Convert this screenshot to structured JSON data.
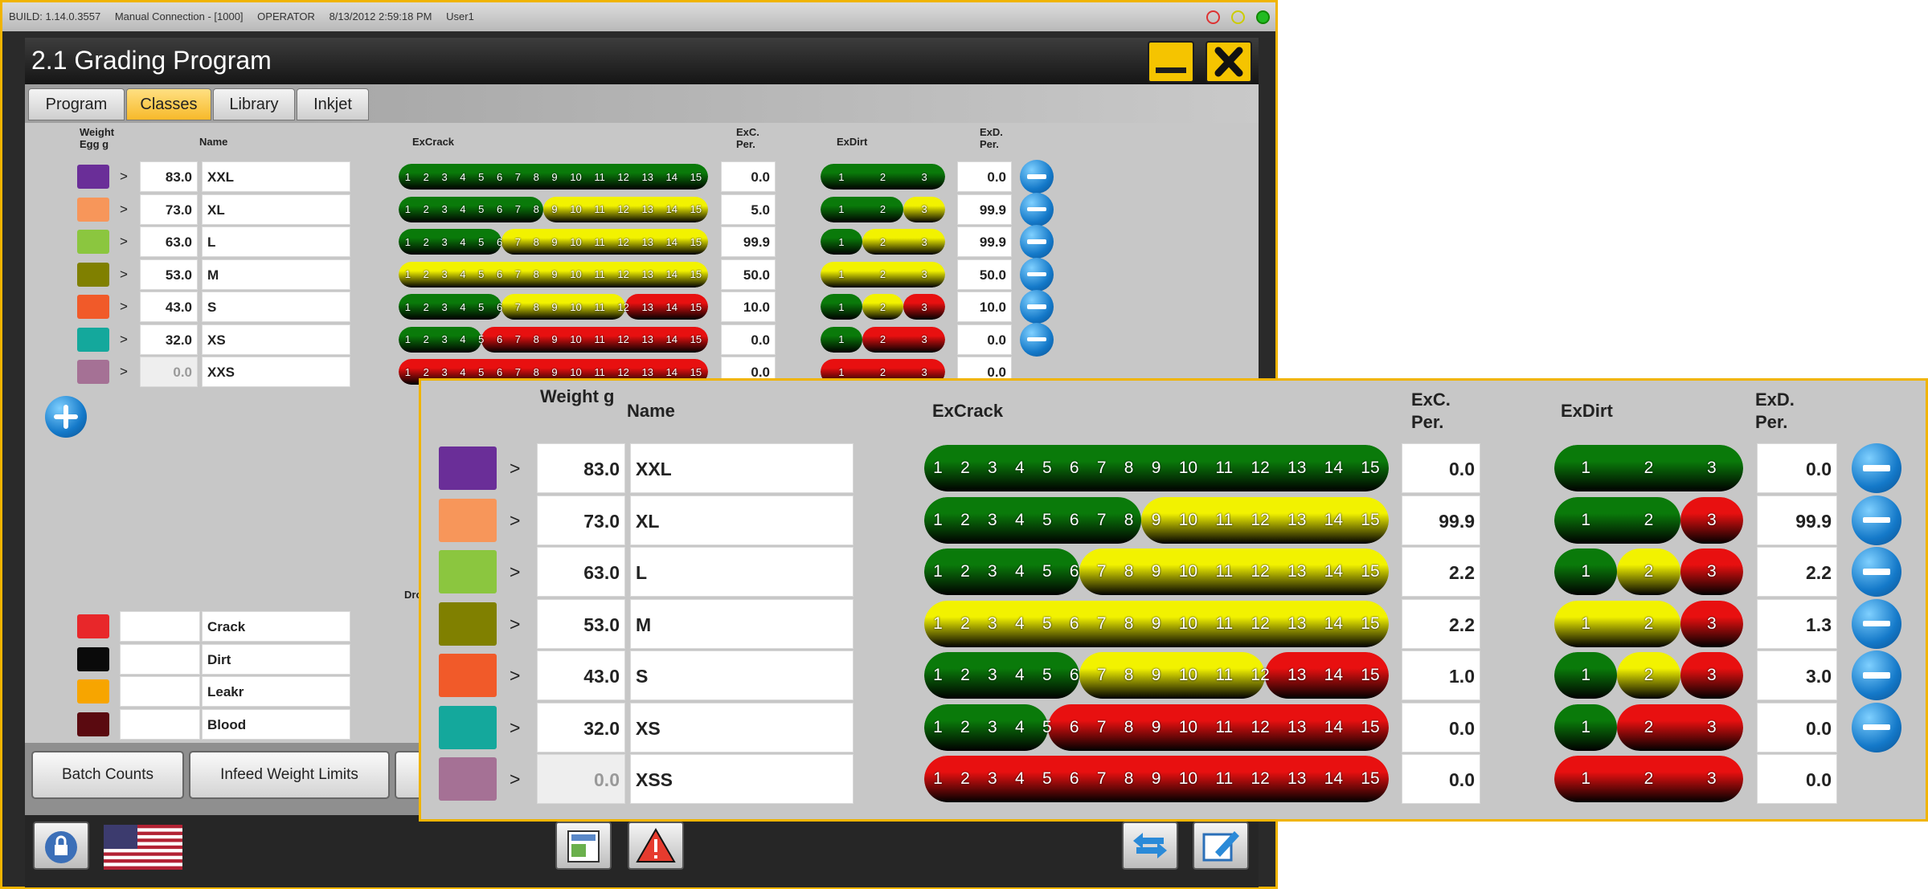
{
  "sysbar": {
    "build": "BUILD: 1.14.0.3557",
    "connection": "Manual Connection - [1000]",
    "role": "OPERATOR",
    "datetime": "8/13/2012 2:59:18 PM",
    "user": "User1"
  },
  "window": {
    "title": "2.1 Grading Program",
    "minimize_icon": "minimize-icon",
    "close_icon": "close-x-icon"
  },
  "tabs": [
    {
      "label": "Program",
      "active": false
    },
    {
      "label": "Classes",
      "active": true
    },
    {
      "label": "Library",
      "active": false
    },
    {
      "label": "Inkjet",
      "active": false
    }
  ],
  "headers": {
    "weight": "Weight Egg  g",
    "name": "Name",
    "excrack": "ExCrack",
    "excper": "ExC. Per.",
    "exdirt": "ExDirt",
    "exdper": "ExD. Per."
  },
  "crack_scale": [
    "1",
    "2",
    "3",
    "4",
    "5",
    "6",
    "7",
    "8",
    "9",
    "10",
    "11",
    "12",
    "13",
    "14",
    "15"
  ],
  "dirt_scale": [
    "1",
    "2",
    "3"
  ],
  "colors": {
    "green": "#0a7a0a",
    "yellow": "#f2f200",
    "red": "#e81010",
    "accent": "#f5c400"
  },
  "classes": [
    {
      "color": "#6a2e98",
      "op": ">",
      "weight": "83.0",
      "name": "XXL",
      "excrack": [
        [
          "g",
          15
        ]
      ],
      "excper": "0.0",
      "exdirt": [
        [
          "g",
          3
        ]
      ],
      "exdper": "0.0",
      "removable": true
    },
    {
      "color": "#f7965a",
      "op": ">",
      "weight": "73.0",
      "name": "XL",
      "excrack": [
        [
          "g",
          7
        ],
        [
          "y",
          8
        ]
      ],
      "excper": "5.0",
      "exdirt": [
        [
          "g",
          2
        ],
        [
          "y",
          1
        ]
      ],
      "exdper": "99.9",
      "removable": true
    },
    {
      "color": "#8bc63f",
      "op": ">",
      "weight": "63.0",
      "name": "L",
      "excrack": [
        [
          "g",
          5
        ],
        [
          "y",
          10
        ]
      ],
      "excper": "99.9",
      "exdirt": [
        [
          "g",
          1
        ],
        [
          "y",
          2
        ]
      ],
      "exdper": "99.9",
      "removable": true
    },
    {
      "color": "#808000",
      "op": ">",
      "weight": "53.0",
      "name": "M",
      "excrack": [
        [
          "y",
          15
        ]
      ],
      "excper": "50.0",
      "exdirt": [
        [
          "y",
          3
        ]
      ],
      "exdper": "50.0",
      "removable": true
    },
    {
      "color": "#f15a29",
      "op": ">",
      "weight": "43.0",
      "name": "S",
      "excrack": [
        [
          "g",
          5
        ],
        [
          "y",
          6
        ],
        [
          "r",
          4
        ]
      ],
      "excper": "10.0",
      "exdirt": [
        [
          "g",
          1
        ],
        [
          "y",
          1
        ],
        [
          "r",
          1
        ]
      ],
      "exdper": "10.0",
      "removable": true
    },
    {
      "color": "#14a89c",
      "op": ">",
      "weight": "32.0",
      "name": "XS",
      "excrack": [
        [
          "g",
          4
        ],
        [
          "r",
          11
        ]
      ],
      "excper": "0.0",
      "exdirt": [
        [
          "g",
          1
        ],
        [
          "r",
          2
        ]
      ],
      "exdper": "0.0",
      "removable": true
    },
    {
      "color": "#a57195",
      "op": ">",
      "weight": "0.0",
      "name": "XXS",
      "excrack": [
        [
          "r",
          15
        ]
      ],
      "excper": "0.0",
      "exdirt": [
        [
          "r",
          3
        ]
      ],
      "exdper": "0.0",
      "removable": false
    }
  ],
  "defects": [
    {
      "color": "#e8272a",
      "name": "Crack"
    },
    {
      "color": "#0a0a0a",
      "name": "Dirt"
    },
    {
      "color": "#f7a500",
      "name": "Leakr"
    },
    {
      "color": "#5a0a10",
      "name": "Blood"
    }
  ],
  "partial_label": "Dro",
  "bottom_buttons": [
    "Batch Counts",
    "Infeed Weight Limits"
  ],
  "status_icons": [
    "lock-icon",
    "us-flag-icon",
    "report-icon",
    "warning-icon",
    "transfer-icon",
    "edit-icon"
  ],
  "inset": {
    "headers": {
      "weight": "Weight g",
      "name": "Name",
      "excrack": "ExCrack",
      "excper": "ExC. Per.",
      "exdirt": "ExDirt",
      "exdper": "ExD. Per."
    },
    "classes": [
      {
        "color": "#6a2e98",
        "op": ">",
        "weight": "83.0",
        "name": "XXL",
        "excrack": [
          [
            "g",
            15
          ]
        ],
        "excper": "0.0",
        "exdirt": [
          [
            "g",
            3
          ]
        ],
        "exdper": "0.0",
        "removable": true
      },
      {
        "color": "#f7965a",
        "op": ">",
        "weight": "73.0",
        "name": "XL",
        "excrack": [
          [
            "g",
            7
          ],
          [
            "y",
            8
          ]
        ],
        "excper": "99.9",
        "exdirt": [
          [
            "g",
            2
          ],
          [
            "r",
            1
          ]
        ],
        "exdper": "99.9",
        "removable": true
      },
      {
        "color": "#8bc63f",
        "op": ">",
        "weight": "63.0",
        "name": "L",
        "excrack": [
          [
            "g",
            5
          ],
          [
            "y",
            10
          ]
        ],
        "excper": "2.2",
        "exdirt": [
          [
            "g",
            1
          ],
          [
            "y",
            1
          ],
          [
            "r",
            1
          ]
        ],
        "exdper": "2.2",
        "removable": true
      },
      {
        "color": "#808000",
        "op": ">",
        "weight": "53.0",
        "name": "M",
        "excrack": [
          [
            "y",
            15
          ]
        ],
        "excper": "2.2",
        "exdirt": [
          [
            "y",
            2
          ],
          [
            "r",
            1
          ]
        ],
        "exdper": "1.3",
        "removable": true
      },
      {
        "color": "#f15a29",
        "op": ">",
        "weight": "43.0",
        "name": "S",
        "excrack": [
          [
            "g",
            5
          ],
          [
            "y",
            6
          ],
          [
            "r",
            4
          ]
        ],
        "excper": "1.0",
        "exdirt": [
          [
            "g",
            1
          ],
          [
            "y",
            1
          ],
          [
            "r",
            1
          ]
        ],
        "exdper": "3.0",
        "removable": true
      },
      {
        "color": "#14a89c",
        "op": ">",
        "weight": "32.0",
        "name": "XS",
        "excrack": [
          [
            "g",
            4
          ],
          [
            "r",
            11
          ]
        ],
        "excper": "0.0",
        "exdirt": [
          [
            "g",
            1
          ],
          [
            "r",
            2
          ]
        ],
        "exdper": "0.0",
        "removable": true
      },
      {
        "color": "#a57195",
        "op": ">",
        "weight": "0.0",
        "name": "XSS",
        "excrack": [
          [
            "r",
            15
          ]
        ],
        "excper": "0.0",
        "exdirt": [
          [
            "r",
            3
          ]
        ],
        "exdper": "0.0",
        "removable": false
      }
    ]
  }
}
